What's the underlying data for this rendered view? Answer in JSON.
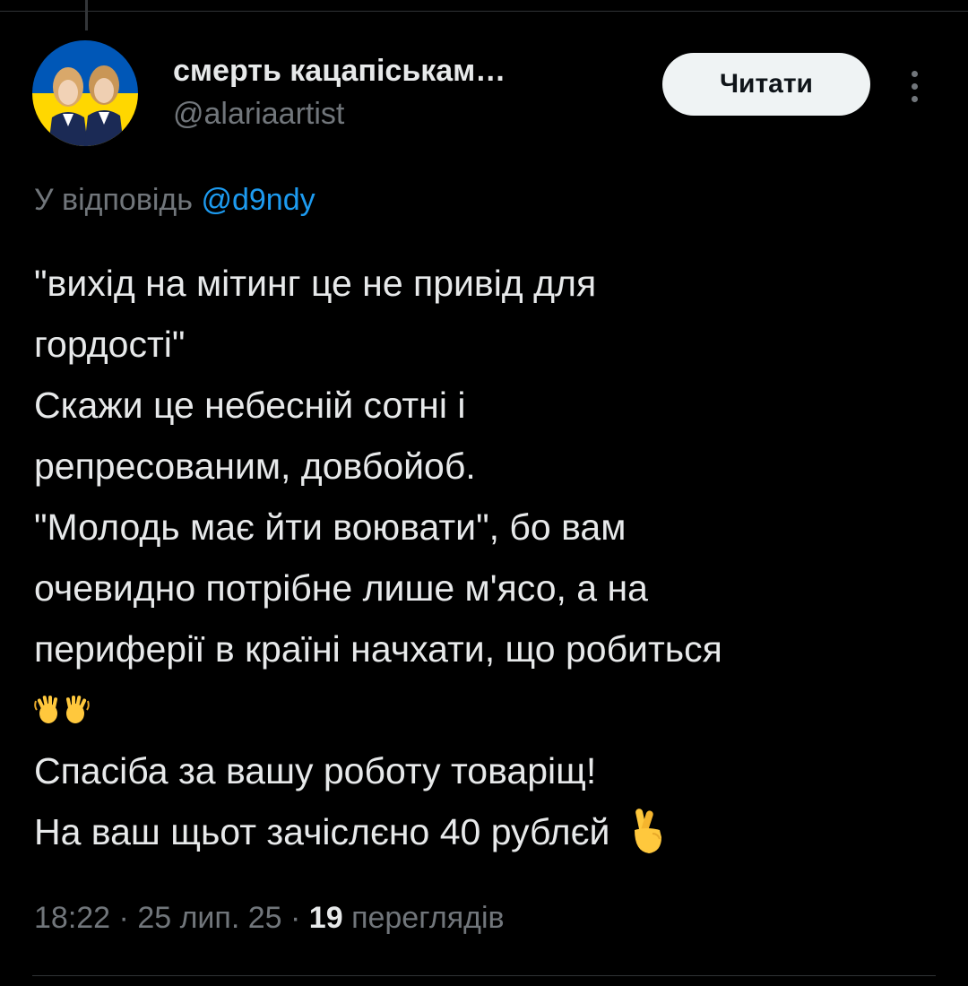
{
  "tweet": {
    "author": {
      "name": "смерть кацапіськам…",
      "handle": "@alariaartist",
      "avatar_icon": "avatar-photo-ukraine-flag"
    },
    "follow_label": "Читати",
    "more_icon": "more-vertical-icon",
    "reply_prefix": "У відповідь",
    "reply_to": "@d9ndy",
    "text_lines": [
      "\"вихід на мітинг це не привід для",
      "гордості\"",
      "Скажи це небесній сотні і",
      "репресованим, довбойоб.",
      "\"Молодь має йти воювати\", бо вам",
      "очевидно потрібне лише м'ясо, а на",
      "периферії в країні начхати, що робиться",
      "",
      "Спасіба за вашу роботу товаріщ!",
      "На ваш щьот зачіслєно 40 рублєй"
    ],
    "emoji_icons": [
      "waving-hands-emoji",
      "crossed-fingers-emoji"
    ],
    "time": "18:22",
    "date": "25 лип. 25",
    "separator": "·",
    "views_count": "19",
    "views_label": "переглядів"
  },
  "colors": {
    "background": "#000000",
    "text": "#e7e9ea",
    "secondary": "#71767b",
    "link": "#1d9bf0",
    "button_bg": "#eff3f4",
    "flag_blue": "#0057b7",
    "flag_yellow": "#ffd700"
  }
}
